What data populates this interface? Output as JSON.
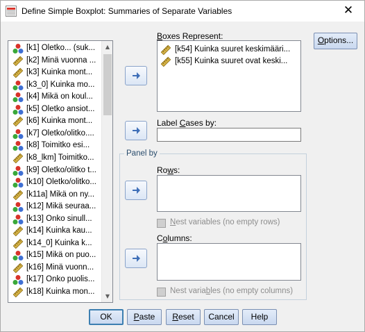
{
  "window": {
    "title": "Define Simple Boxplot: Summaries of Separate Variables",
    "close_glyph": "✕",
    "icon": "spss-dialog-icon"
  },
  "source_list": {
    "items": [
      {
        "label": "[k1] Oletko... (suk...",
        "type": "nominal"
      },
      {
        "label": "[k2] Minä vuonna ...",
        "type": "scale"
      },
      {
        "label": "[k3] Kuinka mont...",
        "type": "scale"
      },
      {
        "label": "[k3_0] Kuinka mo...",
        "type": "nominal"
      },
      {
        "label": "[k4] Mikä on koul...",
        "type": "nominal"
      },
      {
        "label": "[k5] Oletko ansiot...",
        "type": "nominal"
      },
      {
        "label": "[k6] Kuinka mont...",
        "type": "scale"
      },
      {
        "label": "[k7] Oletko/olitko....",
        "type": "nominal"
      },
      {
        "label": "[k8] Toimitko esi...",
        "type": "nominal"
      },
      {
        "label": "[k8_lkm] Toimitko...",
        "type": "scale"
      },
      {
        "label": "[k9] Oletko/olitko t...",
        "type": "nominal"
      },
      {
        "label": "[k10] Oletko/olitko...",
        "type": "nominal"
      },
      {
        "label": "[k11a] Mikä on ny...",
        "type": "scale"
      },
      {
        "label": "[k12] Mikä seuraa...",
        "type": "nominal"
      },
      {
        "label": "[k13] Onko sinull...",
        "type": "nominal"
      },
      {
        "label": "[k14] Kuinka kau...",
        "type": "scale"
      },
      {
        "label": "[k14_0] Kuinka k...",
        "type": "scale"
      },
      {
        "label": "[k15] Mikä on puo...",
        "type": "nominal"
      },
      {
        "label": "[k16] Minä vuonn...",
        "type": "scale"
      },
      {
        "label": "[k17] Onko puolis...",
        "type": "nominal"
      },
      {
        "label": "[k18] Kuinka mon...",
        "type": "scale"
      }
    ],
    "scroll_up": "▲",
    "scroll_down": "▼"
  },
  "boxes_represent": {
    "label_before": "",
    "label_u": "B",
    "label_after": "oxes Represent:",
    "items": [
      {
        "label": "[k54] Kuinka suuret keskimääri...",
        "type": "scale"
      },
      {
        "label": "[k55] Kuinka suuret ovat keski...",
        "type": "scale"
      }
    ]
  },
  "label_cases": {
    "label_before": "Label ",
    "label_u": "C",
    "label_after": "ases by:",
    "value": ""
  },
  "panel_by": {
    "legend": "Panel by",
    "rows_label_before": "Ro",
    "rows_label_u": "w",
    "rows_label_after": "s:",
    "rows_nest_before": "",
    "rows_nest_u": "N",
    "rows_nest_after": "est variables (no empty rows)",
    "columns_label_before": "C",
    "columns_label_u": "o",
    "columns_label_after": "lumns:",
    "columns_nest_before": "Nest varia",
    "columns_nest_u": "b",
    "columns_nest_after": "les (no empty columns)"
  },
  "buttons": {
    "options": {
      "before": "",
      "u": "O",
      "after": "ptions..."
    },
    "ok": {
      "before": "OK",
      "u": "",
      "after": ""
    },
    "paste": {
      "before": "",
      "u": "P",
      "after": "aste"
    },
    "reset": {
      "before": "",
      "u": "R",
      "after": "eset"
    },
    "cancel": {
      "before": "Cancel",
      "u": "",
      "after": ""
    },
    "help": {
      "before": "Help",
      "u": "",
      "after": ""
    }
  },
  "colors": {
    "move_arrow": "#3f6fb8",
    "ruler": "#d6b347",
    "nominal_red": "#d8332a",
    "nominal_green": "#3aa83a",
    "nominal_blue": "#3f6fd3"
  }
}
